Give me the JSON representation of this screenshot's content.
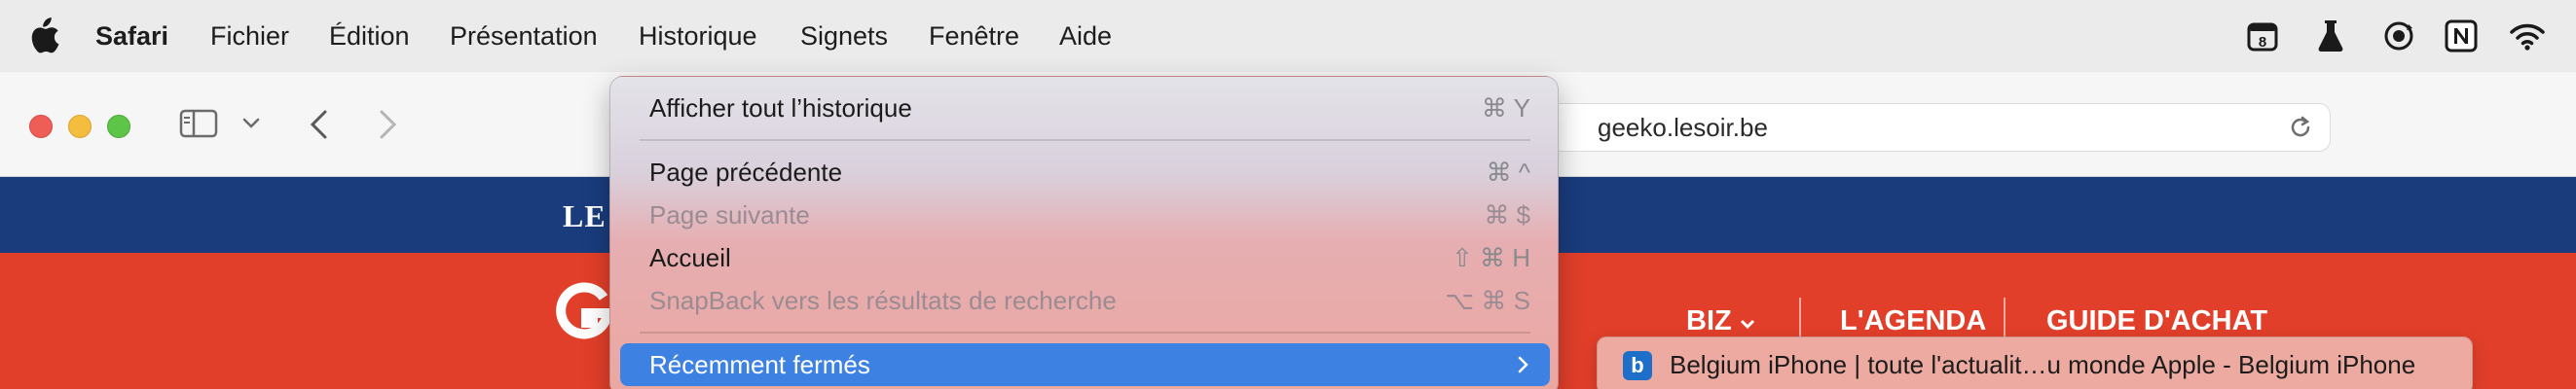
{
  "menubar": {
    "app_name": "Safari",
    "items": [
      "Fichier",
      "Édition",
      "Présentation",
      "Historique",
      "Signets",
      "Fenêtre",
      "Aide"
    ],
    "calendar_day": "8"
  },
  "toolbar": {
    "url": "geeko.lesoir.be"
  },
  "website": {
    "brand": "LE",
    "nav": [
      "BIZ",
      "L'AGENDA",
      "GUIDE D'ACHAT"
    ]
  },
  "history_menu": {
    "items": [
      {
        "label": "Afficher tout l’historique",
        "shortcut": "⌘ Y"
      },
      {
        "label": "Page précédente",
        "shortcut": "⌘ ^"
      },
      {
        "label": "Page suivante",
        "shortcut": "⌘ $"
      },
      {
        "label": "Accueil",
        "shortcut": "⇧ ⌘ H"
      },
      {
        "label": "SnapBack vers les résultats de recherche",
        "shortcut": "⌥ ⌘ S"
      },
      {
        "label": "Récemment fermés",
        "shortcut": ""
      }
    ]
  },
  "recently_closed": {
    "items": [
      {
        "favicon": "b",
        "label": "Belgium iPhone | toute l'actualit…u monde Apple - Belgium iPhone"
      }
    ]
  },
  "colors": {
    "selection": "#3d82e3",
    "site_header": "#1a3c7d",
    "site_nav": "#e23f2a"
  }
}
